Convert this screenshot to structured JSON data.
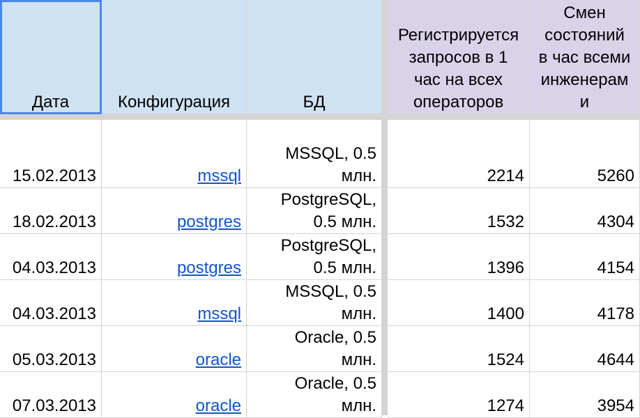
{
  "headers": {
    "date": "Дата",
    "config": "Конфигурация",
    "db": "БД",
    "requests": [
      "Регистрируется",
      "запросов в 1",
      "час на всех",
      "операторов"
    ],
    "changes": [
      "Смен",
      "состояний",
      "в час всеми",
      "инженерам",
      "и"
    ]
  },
  "rows": [
    {
      "date": "15.02.2013",
      "config": "mssql",
      "db": [
        "MSSQL, 0.5",
        "млн."
      ],
      "requests": "2214",
      "changes": "5260"
    },
    {
      "date": "18.02.2013",
      "config": "postgres",
      "db": [
        "PostgreSQL,",
        "0.5 млн."
      ],
      "requests": "1532",
      "changes": "4304"
    },
    {
      "date": "04.03.2013",
      "config": "postgres",
      "db": [
        "PostgreSQL,",
        "0.5 млн."
      ],
      "requests": "1396",
      "changes": "4154"
    },
    {
      "date": "04.03.2013",
      "config": "mssql",
      "db": [
        "MSSQL, 0.5",
        "млн."
      ],
      "requests": "1400",
      "changes": "4178"
    },
    {
      "date": "05.03.2013",
      "config": "oracle",
      "db": [
        "Oracle, 0.5",
        "млн."
      ],
      "requests": "1524",
      "changes": "4644"
    },
    {
      "date": "07.03.2013",
      "config": "oracle",
      "db": [
        "Oracle, 0.5",
        "млн."
      ],
      "requests": "1274",
      "changes": "3954"
    }
  ],
  "colors": {
    "header_blue": "#cfe2f3",
    "header_purple": "#d9d2e9",
    "link": "#1155cc",
    "selection": "#4a86e8"
  }
}
